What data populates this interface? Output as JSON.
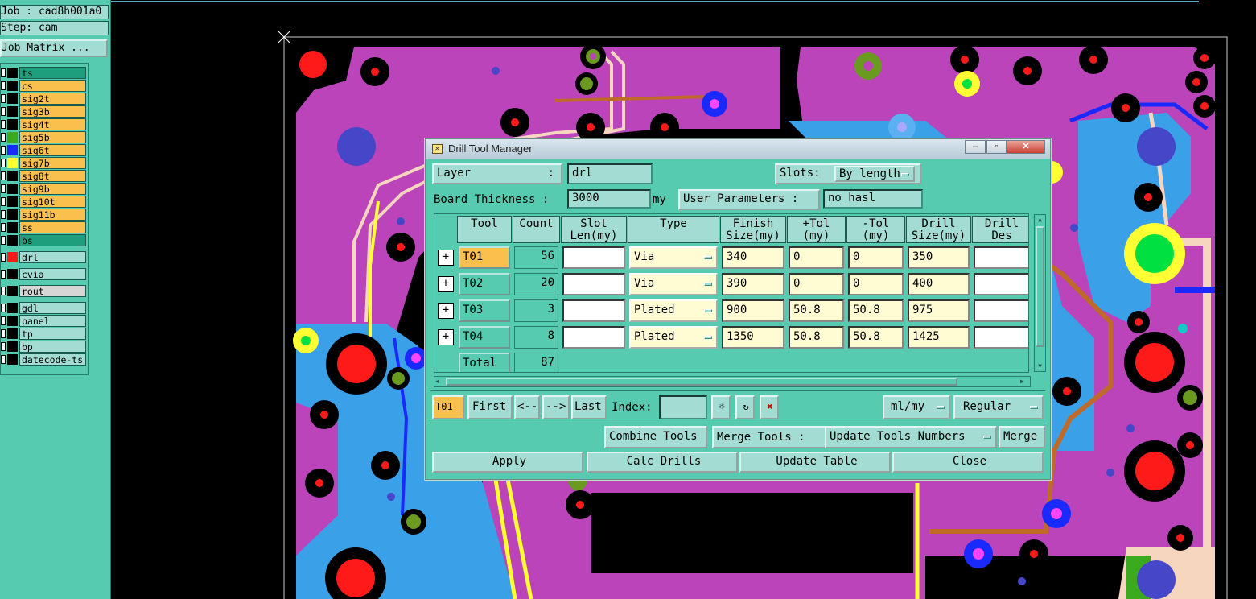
{
  "left_panel": {
    "job_label": "Job : cad8h001a0",
    "step_label": "Step: cam",
    "job_matrix_button": "Job Matrix ...",
    "layers": [
      {
        "name": "ts",
        "bg": "#1e9e7c",
        "swatch": "#000000"
      },
      {
        "name": "cs",
        "bg": "#f9c04e",
        "swatch": "#000000"
      },
      {
        "name": "sig2t",
        "bg": "#f9c04e",
        "swatch": "#000000"
      },
      {
        "name": "sig3b",
        "bg": "#f9c04e",
        "swatch": "#000000"
      },
      {
        "name": "sig4t",
        "bg": "#f9c04e",
        "swatch": "#000000"
      },
      {
        "name": "sig5b",
        "bg": "#f9c04e",
        "swatch": "#3caa1e"
      },
      {
        "name": "sig6t",
        "bg": "#f9c04e",
        "swatch": "#1a2aff"
      },
      {
        "name": "sig7b",
        "bg": "#f9c04e",
        "swatch": "#ffff2a"
      },
      {
        "name": "sig8t",
        "bg": "#f9c04e",
        "swatch": "#000000"
      },
      {
        "name": "sig9b",
        "bg": "#f9c04e",
        "swatch": "#000000"
      },
      {
        "name": "sig10t",
        "bg": "#f9c04e",
        "swatch": "#000000"
      },
      {
        "name": "sig11b",
        "bg": "#f9c04e",
        "swatch": "#000000"
      },
      {
        "name": "ss",
        "bg": "#f9c04e",
        "swatch": "#000000"
      },
      {
        "name": "bs",
        "bg": "#1e9e7c",
        "swatch": "#000000"
      },
      {
        "name": "drl",
        "bg": "#a2dcd2",
        "swatch": "#ff1a1a"
      },
      {
        "name": "cvia",
        "bg": "#a2dcd2",
        "swatch": "#000000"
      },
      {
        "name": "rout",
        "bg": "#d6d6d6",
        "swatch": "#000000"
      },
      {
        "name": "gdl",
        "bg": "#a2dcd2",
        "swatch": "#000000"
      },
      {
        "name": "panel",
        "bg": "#a2dcd2",
        "swatch": "#000000"
      },
      {
        "name": "tp",
        "bg": "#a2dcd2",
        "swatch": "#000000"
      },
      {
        "name": "bp",
        "bg": "#a2dcd2",
        "swatch": "#000000"
      },
      {
        "name": "datecode-ts",
        "bg": "#a2dcd2",
        "swatch": "#000000"
      }
    ]
  },
  "dialog": {
    "title": "Drill Tool Manager",
    "layer_label": "Layer",
    "layer_colon": ":",
    "layer_value": "drl",
    "slots_label": "Slots:",
    "slots_value": "By length",
    "board_thickness_label": "Board Thickness :",
    "board_thickness_value": "3000",
    "board_thickness_unit": "my",
    "user_params_label": "User Parameters :",
    "user_params_value": "no_hasl",
    "columns": [
      "Tool",
      "Count",
      "Slot\nLen(my)",
      "Type",
      "Finish\nSize(my)",
      "+Tol\n(my)",
      "-Tol\n(my)",
      "Drill\nSize(my)",
      "Drill\nDes"
    ],
    "rows": [
      {
        "tool": "T01",
        "count": "56",
        "slot_len": "",
        "type": "Via",
        "finish": "340",
        "plus_tol": "0",
        "minus_tol": "0",
        "drill": "350",
        "des": ""
      },
      {
        "tool": "T02",
        "count": "20",
        "slot_len": "",
        "type": "Via",
        "finish": "390",
        "plus_tol": "0",
        "minus_tol": "0",
        "drill": "400",
        "des": ""
      },
      {
        "tool": "T03",
        "count": "3",
        "slot_len": "",
        "type": "Plated",
        "finish": "900",
        "plus_tol": "50.8",
        "minus_tol": "50.8",
        "drill": "975",
        "des": ""
      },
      {
        "tool": "T04",
        "count": "8",
        "slot_len": "",
        "type": "Plated",
        "finish": "1350",
        "plus_tol": "50.8",
        "minus_tol": "50.8",
        "drill": "1425",
        "des": ""
      }
    ],
    "total_label": "Total",
    "total_count": "87",
    "nav": {
      "current_tool": "T01",
      "first": "First",
      "prev": "<--",
      "next": "-->",
      "last": "Last",
      "index_label": "Index:",
      "units": "ml/my",
      "mode": "Regular"
    },
    "combine_tools": "Combine Tools",
    "merge_tools_label": "Merge Tools :",
    "merge_option": "Update Tools Numbers",
    "merge_button": "Merge",
    "apply": "Apply",
    "calc_drills": "Calc Drills",
    "update_table": "Update Table",
    "close": "Close"
  }
}
